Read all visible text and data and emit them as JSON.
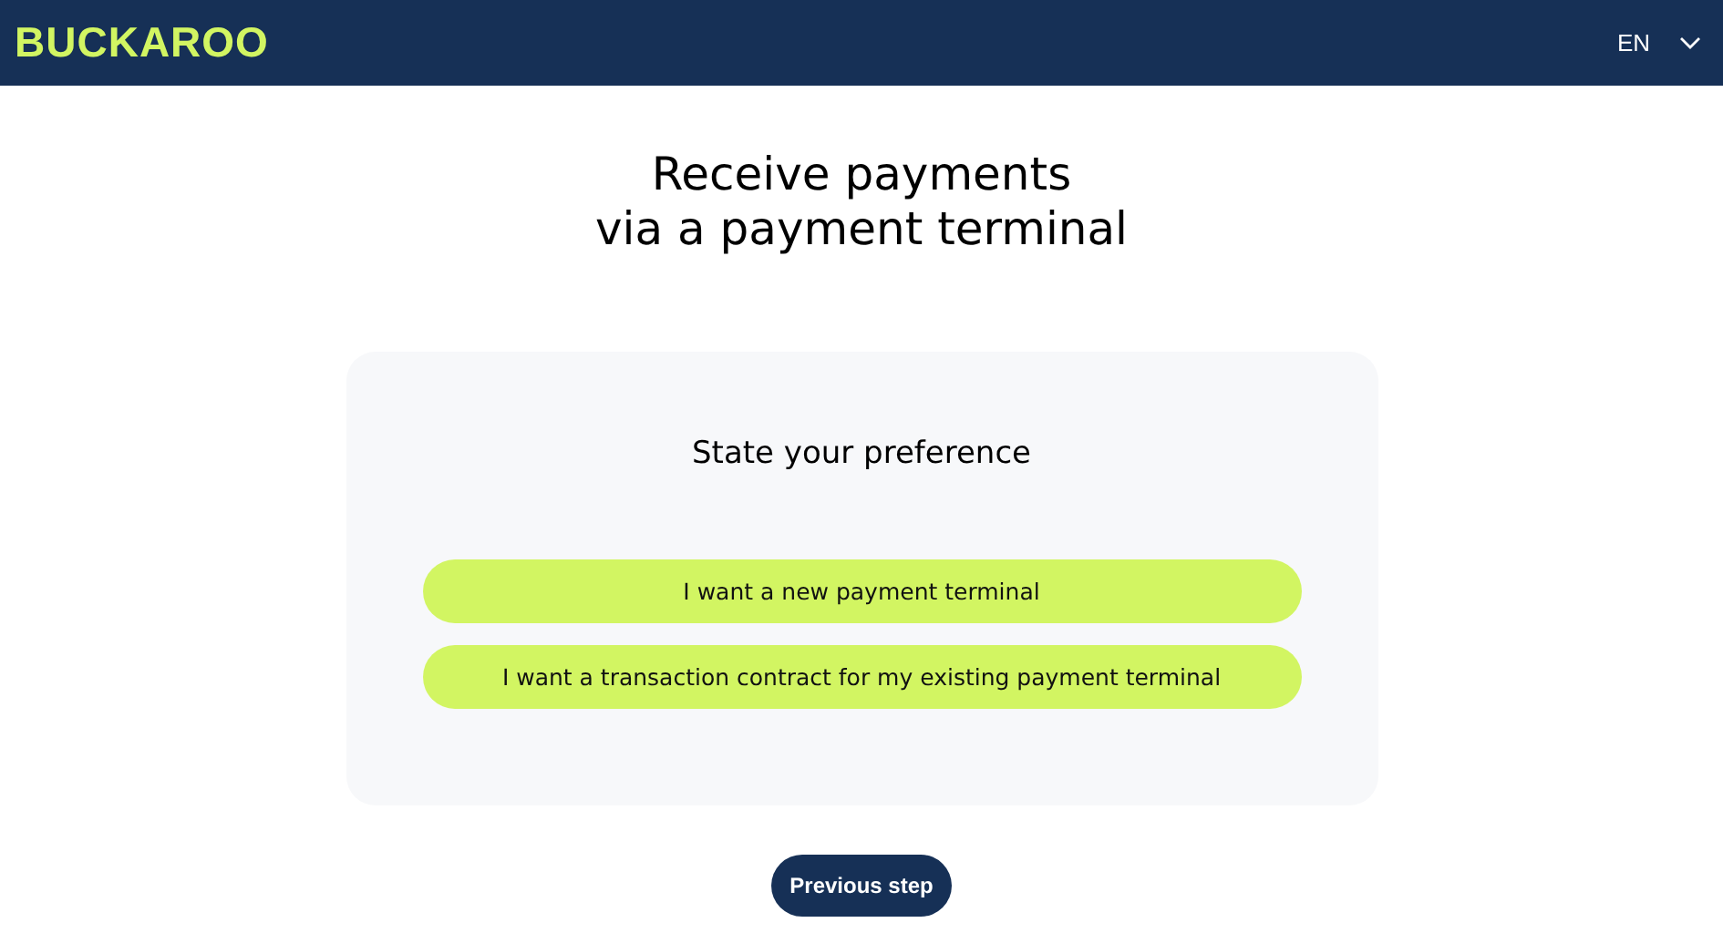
{
  "header": {
    "logo": "BUCKAROO",
    "language": "EN"
  },
  "title_lines": [
    "Receive payments",
    "via a payment terminal"
  ],
  "card": {
    "heading": "State your preference",
    "options": [
      {
        "label": "I want a new payment terminal"
      },
      {
        "label": "I want a transaction contract for my existing payment terminal"
      }
    ]
  },
  "back_button": "Previous step"
}
